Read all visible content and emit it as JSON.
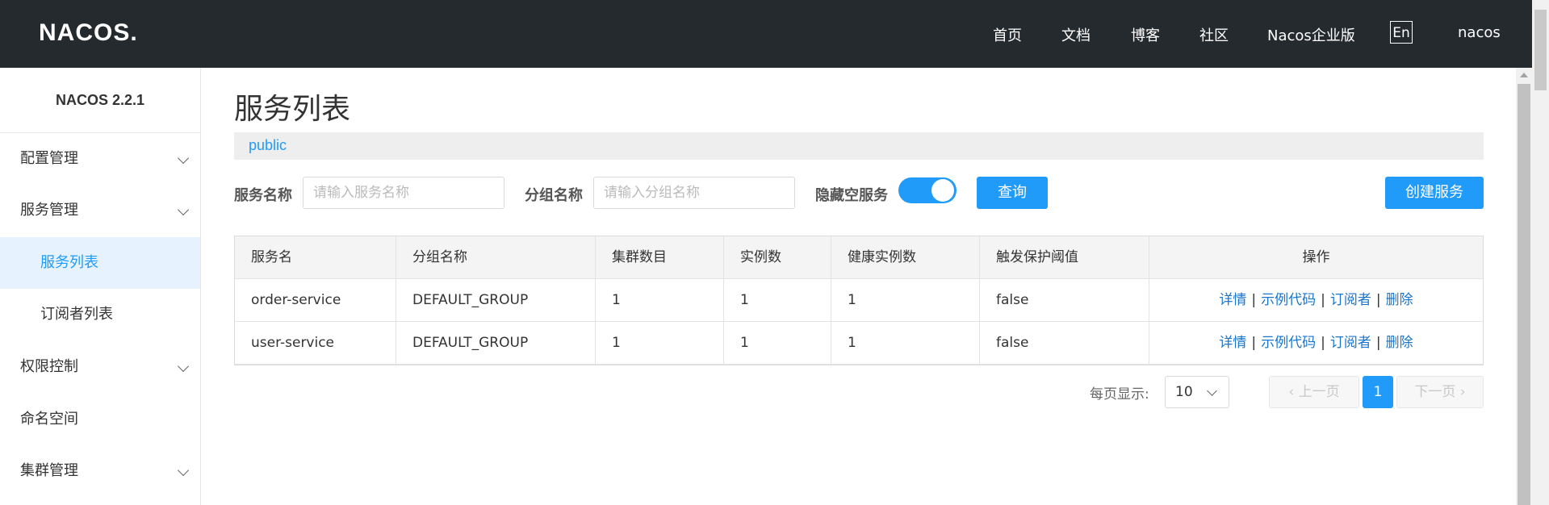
{
  "header": {
    "logo": "NACOS.",
    "nav": [
      "首页",
      "文档",
      "博客",
      "社区",
      "Nacos企业版"
    ],
    "lang": "En",
    "user": "nacos"
  },
  "sidebar": {
    "version": "NACOS 2.2.1",
    "items": [
      {
        "label": "配置管理",
        "expandable": true
      },
      {
        "label": "服务管理",
        "expandable": true
      },
      {
        "label": "服务列表",
        "sub": true,
        "active": true
      },
      {
        "label": "订阅者列表",
        "sub": true
      },
      {
        "label": "权限控制",
        "expandable": true
      },
      {
        "label": "命名空间"
      },
      {
        "label": "集群管理",
        "expandable": true
      }
    ]
  },
  "main": {
    "title": "服务列表",
    "namespace": "public",
    "filters": {
      "service_label": "服务名称",
      "service_placeholder": "请输入服务名称",
      "group_label": "分组名称",
      "group_placeholder": "请输入分组名称",
      "hide_empty_label": "隐藏空服务",
      "hide_empty_on": true,
      "query_button": "查询",
      "create_button": "创建服务"
    },
    "table": {
      "columns": [
        "服务名",
        "分组名称",
        "集群数目",
        "实例数",
        "健康实例数",
        "触发保护阈值",
        "操作"
      ],
      "rows": [
        {
          "name": "order-service",
          "group": "DEFAULT_GROUP",
          "clusters": "1",
          "instances": "1",
          "healthy": "1",
          "threshold": "false"
        },
        {
          "name": "user-service",
          "group": "DEFAULT_GROUP",
          "clusters": "1",
          "instances": "1",
          "healthy": "1",
          "threshold": "false"
        }
      ],
      "ops": [
        "详情",
        "示例代码",
        "订阅者",
        "删除"
      ],
      "op_separator": "|"
    },
    "pagination": {
      "page_size_label": "每页显示:",
      "page_size": "10",
      "prev": "上一页",
      "next": "下一页",
      "current_page": "1"
    }
  },
  "colors": {
    "topbar": "#252a2f",
    "accent": "#209bfa",
    "link": "#1a75cc",
    "active_bg": "#e6f3fe"
  }
}
